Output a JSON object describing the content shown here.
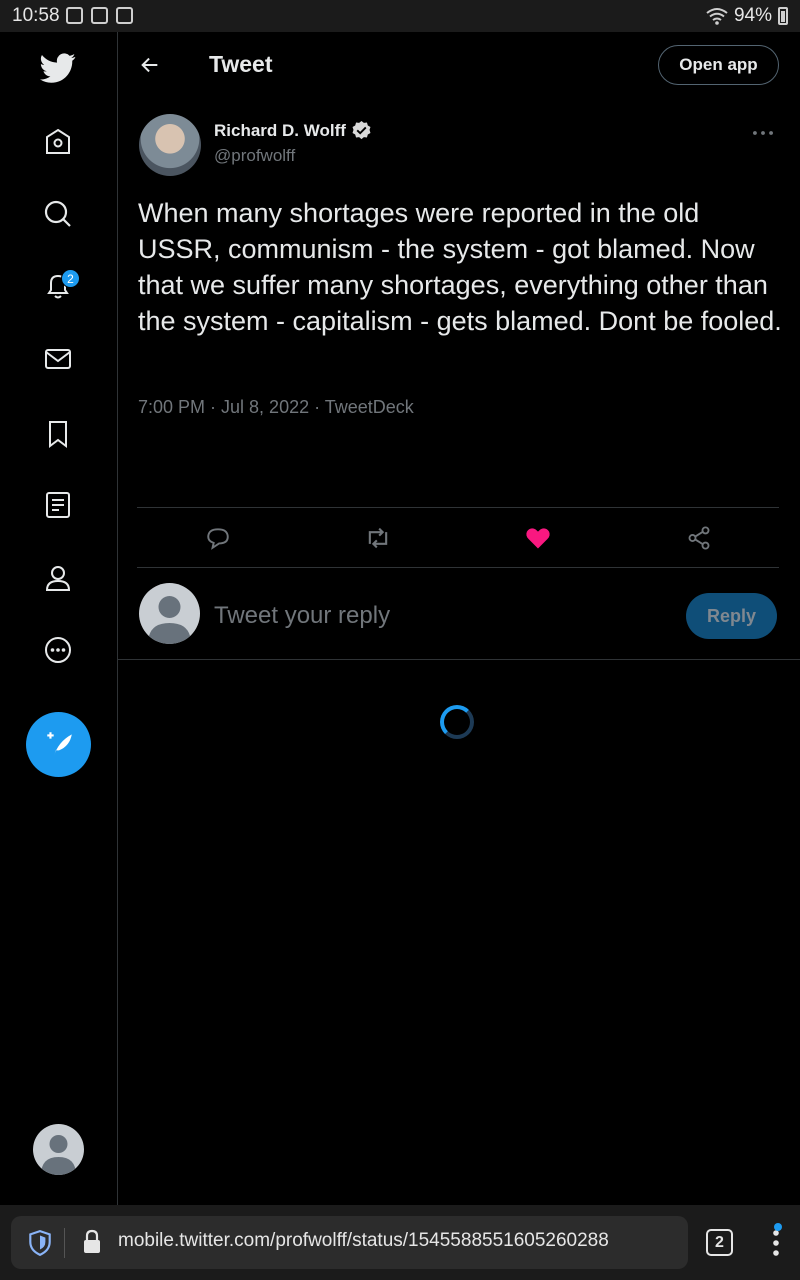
{
  "status_bar": {
    "time": "10:58",
    "battery": "94%"
  },
  "sidebar": {
    "notification_count": "2",
    "items": [
      {
        "name": "twitter-logo"
      },
      {
        "name": "home"
      },
      {
        "name": "explore"
      },
      {
        "name": "notifications"
      },
      {
        "name": "messages"
      },
      {
        "name": "bookmarks"
      },
      {
        "name": "lists"
      },
      {
        "name": "profile"
      },
      {
        "name": "more"
      }
    ]
  },
  "header": {
    "title": "Tweet",
    "open_app_label": "Open app"
  },
  "tweet": {
    "author_name": "Richard D. Wolff",
    "author_handle": "@profwolff",
    "text": "When many shortages were reported in the old USSR, communism - the system - got blamed. Now that we suffer many shortages, everything other than the system - capitalism - gets blamed. Dont be fooled.",
    "meta": "7:00 PM · Jul 8, 2022 · TweetDeck",
    "liked": true
  },
  "reply": {
    "placeholder": "Tweet your reply",
    "button_label": "Reply"
  },
  "browser": {
    "url": "mobile.twitter.com/profwolff/status/1545588551605260288",
    "tab_count": "2"
  },
  "colors": {
    "accent": "#1d9bf0",
    "like": "#f91880",
    "background": "#000000",
    "border": "#2f3336",
    "secondary_text": "#71767b"
  }
}
